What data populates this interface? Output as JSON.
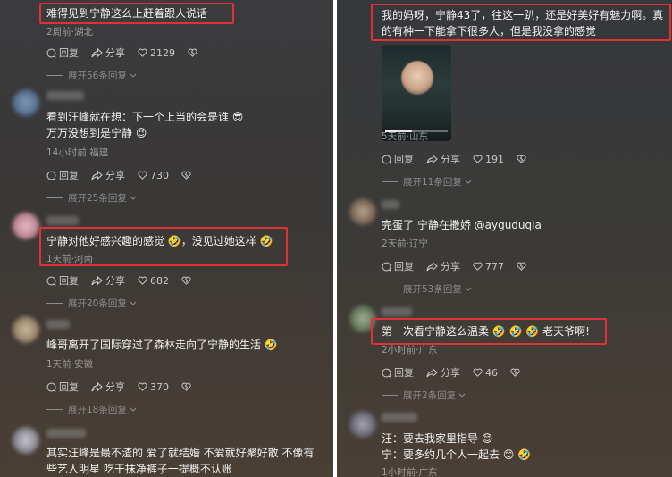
{
  "left": {
    "comments": [
      {
        "text_lines": [
          "难得见到宁静这么上赶着跟人说话"
        ],
        "meta": "2周前·湖北",
        "reply": "回复",
        "share": "分享",
        "likes": "2129",
        "expand": "展开56条回复"
      },
      {
        "text_lines": [
          "看到汪峰就在想：下一个上当的会是谁 😎",
          "万万没想到是宁静 😉"
        ],
        "meta": "14小时前·福建",
        "reply": "回复",
        "share": "分享",
        "likes": "730",
        "expand": "展开25条回复"
      },
      {
        "text_lines": [
          "宁静对他好感兴趣的感觉 🤣，没见过她这样 🤣"
        ],
        "meta": "1天前·河南",
        "reply": "回复",
        "share": "分享",
        "likes": "682",
        "expand": "展开20条回复"
      },
      {
        "text_lines": [
          "峰哥离开了国际穿过了森林走向了宁静的生活 🤣"
        ],
        "meta": "1天前·安徽",
        "reply": "回复",
        "share": "分享",
        "likes": "370",
        "expand": "展开18条回复"
      },
      {
        "text_lines": [
          "其实汪峰是最不渣的  爱了就结婚  不爱就好聚好散  不像有",
          "些艺人明星  吃干抹净裤子一提概不认账"
        ]
      }
    ]
  },
  "right": {
    "comments": [
      {
        "text_lines": [
          "我的妈呀，宁静43了，往这一趴，还是好美好有魅力啊。真",
          "的有种一下能拿下很多人，但是我没拿的感觉"
        ],
        "meta": "5天前·山东",
        "reply": "回复",
        "share": "分享",
        "likes": "191",
        "expand": "展开11条回复"
      },
      {
        "text_lines": [
          "完蛋了 宁静在撒娇 @ayguduqia"
        ],
        "meta": "2天前·辽宁",
        "reply": "回复",
        "share": "分享",
        "likes": "777",
        "expand": "展开53条回复"
      },
      {
        "text_lines": [
          "第一次看宁静这么温柔 🤣 🤣 🤣 老天爷啊!"
        ],
        "meta": "2小时前·广东",
        "reply": "回复",
        "share": "分享",
        "likes": "46",
        "expand": "展开2条回复"
      },
      {
        "text_lines": [
          "汪：要去我家里指导 😊",
          "宁：要多约几个人一起去 😊 🤣"
        ],
        "meta": "1小时前·广东"
      }
    ]
  },
  "colors": {
    "highlight": "#e0303a",
    "text": "#f1f1f1",
    "meta": "#9a9a9a"
  }
}
